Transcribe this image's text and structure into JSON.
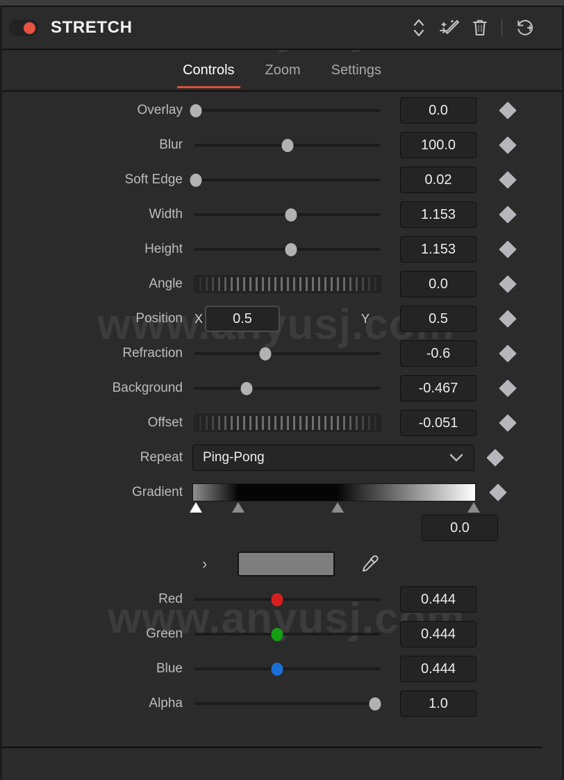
{
  "header": {
    "title": "STRETCH",
    "enabled_toggle": "effect-enabled",
    "accent_color": "#e9523f",
    "icons": [
      {
        "name": "reorder-updown-icon",
        "glyph": "chevrons"
      },
      {
        "name": "magic-wand-icon",
        "glyph": "wand"
      },
      {
        "name": "delete-icon",
        "glyph": "trash"
      },
      {
        "name": "reset-history-icon",
        "glyph": "reset"
      }
    ]
  },
  "watermark": "www.anyusj.com",
  "tabs": [
    {
      "label": "Controls",
      "active": true
    },
    {
      "label": "Zoom",
      "active": false
    },
    {
      "label": "Settings",
      "active": false
    }
  ],
  "parameters": [
    {
      "label": "Overlay",
      "type": "slider",
      "value": "0.0",
      "fraction": 0.02,
      "keyframe": true
    },
    {
      "label": "Blur",
      "type": "slider",
      "value": "100.0",
      "fraction": 0.5,
      "keyframe": true
    },
    {
      "label": "Soft Edge",
      "type": "slider",
      "value": "0.02",
      "fraction": 0.02,
      "keyframe": true
    },
    {
      "label": "Width",
      "type": "slider",
      "value": "1.153",
      "fraction": 0.52,
      "keyframe": true
    },
    {
      "label": "Height",
      "type": "slider",
      "value": "1.153",
      "fraction": 0.52,
      "keyframe": true
    },
    {
      "label": "Angle",
      "type": "scrubber",
      "value": "0.0",
      "keyframe": true
    },
    {
      "label": "Position",
      "type": "xy",
      "x_label": "X",
      "x_value": "0.5",
      "y_label": "Y",
      "y_value": "0.5",
      "keyframe": true
    },
    {
      "label": "Refraction",
      "type": "slider",
      "value": "-0.6",
      "fraction": 0.385,
      "keyframe": true
    },
    {
      "label": "Background",
      "type": "slider",
      "value": "-0.467",
      "fraction": 0.285,
      "keyframe": true
    },
    {
      "label": "Offset",
      "type": "scrubber",
      "value": "-0.051",
      "keyframe": true
    },
    {
      "label": "Repeat",
      "type": "dropdown",
      "value": "Ping-Pong",
      "keyframe": true
    }
  ],
  "gradient": {
    "label": "Gradient",
    "keyframe": true,
    "css": "linear-gradient(to right, #8f8f8f 0%, #050505 16%, #050505 51%, #ffffff 100%)",
    "stops": [
      {
        "position_pct": 1,
        "color": "#8f8f8f",
        "selected": true
      },
      {
        "position_pct": 16,
        "color": "#050505",
        "selected": false
      },
      {
        "position_pct": 51,
        "color": "#050505",
        "selected": false
      },
      {
        "position_pct": 99,
        "color": "#ffffff",
        "selected": false
      }
    ],
    "position_value": "0.0"
  },
  "color_picker": {
    "expander": "›",
    "swatch_color": "#7e7e7e",
    "eyedropper": "eyedropper-icon"
  },
  "color_channels": [
    {
      "label": "Red",
      "value": "0.444",
      "fraction": 0.444,
      "thumb_color": "#d81f1f"
    },
    {
      "label": "Green",
      "value": "0.444",
      "fraction": 0.444,
      "thumb_color": "#13a013"
    },
    {
      "label": "Blue",
      "value": "0.444",
      "fraction": 0.444,
      "thumb_color": "#1a6fd4"
    },
    {
      "label": "Alpha",
      "value": "1.0",
      "fraction": 0.96,
      "thumb_color": "#b2b2b2"
    }
  ]
}
